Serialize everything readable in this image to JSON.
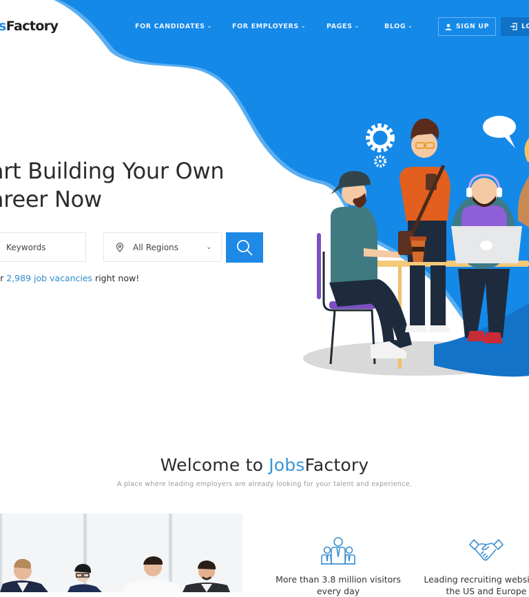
{
  "colors": {
    "brand_blue": "#1e8ae6",
    "blob_edge": "#5aaef0",
    "link": "#2f8ccc",
    "login_bg": "#1072c6"
  },
  "header": {
    "logo_accent": "s",
    "logo_rest": "Factory",
    "nav": [
      {
        "label": "FOR CANDIDATES",
        "icon": "chevron-down-icon"
      },
      {
        "label": "FOR EMPLOYERS",
        "icon": "chevron-down-icon"
      },
      {
        "label": "PAGES",
        "icon": "chevron-down-icon"
      },
      {
        "label": "BLOG",
        "icon": "chevron-down-icon"
      }
    ],
    "signup_label": "SIGN UP",
    "signup_icon": "user-icon",
    "login_label": "LO",
    "login_icon": "login-icon"
  },
  "hero": {
    "title_line1": "art Building Your Own",
    "title_line2": "areer Now",
    "keywords_placeholder": "Keywords",
    "region_selected": "All Regions",
    "region_icon": "map-pin-icon",
    "search_icon": "search-icon",
    "vacancies_prefix": "fer ",
    "vacancies_link": "2,989 job vacancies",
    "vacancies_suffix": " right now!"
  },
  "welcome": {
    "title_prefix": "Welcome to ",
    "title_accent": "Jobs",
    "title_rest": "Factory",
    "subtitle": "A place where leading employers are already looking for your talent and experience."
  },
  "features": [
    {
      "icon": "team-icon",
      "label": "More than 3.8 million visitors every day"
    },
    {
      "icon": "handshake-icon",
      "label": "Leading recruiting website in the US and Europe"
    }
  ]
}
